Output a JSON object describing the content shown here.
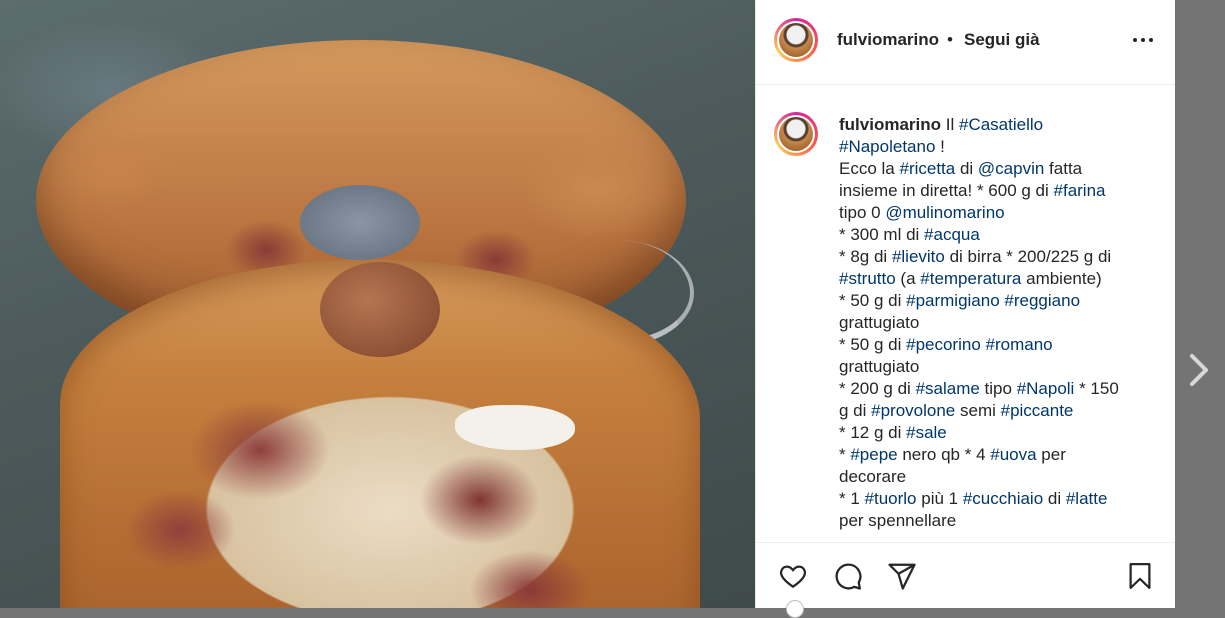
{
  "post": {
    "username": "fulviomarino",
    "separator": "•",
    "follow_label": "Segui già",
    "more_icon": "more-horizontal-icon"
  },
  "caption": {
    "username": "fulviomarino",
    "lines": [
      [
        {
          "t": "Il "
        },
        {
          "t": "#Casatiello",
          "tag": true
        }
      ],
      [
        {
          "t": "#Napoletano",
          "tag": true
        },
        {
          "t": " !"
        }
      ],
      [
        {
          "t": "Ecco la "
        },
        {
          "t": "#ricetta",
          "tag": true
        },
        {
          "t": " di "
        },
        {
          "t": "@capvin",
          "tag": true
        },
        {
          "t": " fatta"
        }
      ],
      [
        {
          "t": "insieme in diretta! * 600 g di "
        },
        {
          "t": "#farina",
          "tag": true
        }
      ],
      [
        {
          "t": "tipo 0 "
        },
        {
          "t": "@mulinomarino",
          "tag": true
        }
      ],
      [
        {
          "t": "* 300 ml di "
        },
        {
          "t": "#acqua",
          "tag": true
        }
      ],
      [
        {
          "t": "* 8g di "
        },
        {
          "t": "#lievito",
          "tag": true
        },
        {
          "t": " di birra * 200/225 g di"
        }
      ],
      [
        {
          "t": "#strutto",
          "tag": true
        },
        {
          "t": " (a "
        },
        {
          "t": "#temperatura",
          "tag": true
        },
        {
          "t": " ambiente)"
        }
      ],
      [
        {
          "t": "* 50 g di "
        },
        {
          "t": "#parmigiano",
          "tag": true
        },
        {
          "t": " "
        },
        {
          "t": "#reggiano",
          "tag": true
        }
      ],
      [
        {
          "t": "grattugiato"
        }
      ],
      [
        {
          "t": "* 50 g di "
        },
        {
          "t": "#pecorino",
          "tag": true
        },
        {
          "t": " "
        },
        {
          "t": "#romano",
          "tag": true
        }
      ],
      [
        {
          "t": "grattugiato"
        }
      ],
      [
        {
          "t": "* 200 g di "
        },
        {
          "t": "#salame",
          "tag": true
        },
        {
          "t": " tipo "
        },
        {
          "t": "#Napoli",
          "tag": true
        },
        {
          "t": " * 150"
        }
      ],
      [
        {
          "t": "g di "
        },
        {
          "t": "#provolone",
          "tag": true
        },
        {
          "t": " semi "
        },
        {
          "t": "#piccante",
          "tag": true
        }
      ],
      [
        {
          "t": "* 12 g di "
        },
        {
          "t": "#sale",
          "tag": true
        }
      ],
      [
        {
          "t": "* "
        },
        {
          "t": "#pepe",
          "tag": true
        },
        {
          "t": " nero qb * 4 "
        },
        {
          "t": "#uova",
          "tag": true
        },
        {
          "t": " per"
        }
      ],
      [
        {
          "t": "decorare"
        }
      ],
      [
        {
          "t": "* 1 "
        },
        {
          "t": "#tuorlo",
          "tag": true
        },
        {
          "t": " più 1 "
        },
        {
          "t": "#cucchiaio",
          "tag": true
        },
        {
          "t": " di "
        },
        {
          "t": "#latte",
          "tag": true
        }
      ],
      [
        {
          "t": "per spennellare"
        }
      ]
    ]
  },
  "actions": {
    "like_icon": "heart-icon",
    "comment_icon": "comment-icon",
    "share_icon": "paper-plane-icon",
    "save_icon": "bookmark-icon"
  },
  "navigation": {
    "next_icon": "chevron-right-icon"
  },
  "colors": {
    "text": "#262626",
    "hashtag": "#00376b",
    "backdrop": "#747474",
    "panel": "#ffffff"
  }
}
